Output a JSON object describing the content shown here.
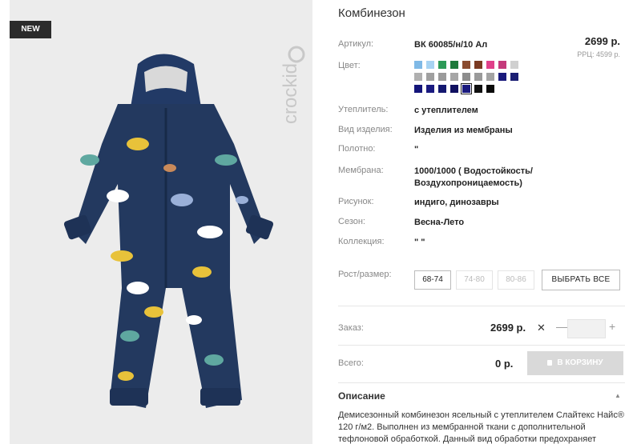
{
  "badge": "NEW",
  "brand": "crockid",
  "title": "Комбинезон",
  "article": {
    "label": "Артикул:",
    "value": "ВК 60085/н/10 Ал"
  },
  "price": "2699 р.",
  "rrp": "РРЦ: 4599 р.",
  "color": {
    "label": "Цвет:",
    "swatches": [
      "#7fb9e6",
      "#a7d3f2",
      "#2d9a57",
      "#1f7a3c",
      "#8a4b2f",
      "#7b3a22",
      "#e0408a",
      "#c43a7b",
      "#d0d0d0",
      "#b0b0b0",
      "#a0a0a0",
      "#9b9b9b",
      "#a6a6a6",
      "#8d8d8d",
      "#9a9a9a",
      "#a3a3a3",
      "#1a1a7c",
      "#1b1f73",
      "#14157a",
      "#1a1a80",
      "#141870",
      "#101060",
      "#1a1a7e",
      "#101010",
      "#0a0a0a"
    ],
    "selected_index": 22
  },
  "fields": [
    {
      "label": "Утеплитель:",
      "value": "с утеплителем"
    },
    {
      "label": "Вид изделия:",
      "value": "Изделия из мембраны"
    },
    {
      "label": "Полотно:",
      "value": "\""
    },
    {
      "label": "Мембрана:",
      "value": "1000/1000 ( Водостойкость/ Воздухопроницаемость)"
    },
    {
      "label": "Рисунок:",
      "value": "индиго, динозавры"
    },
    {
      "label": "Сезон:",
      "value": "Весна-Лето"
    },
    {
      "label": "Коллекция:",
      "value": "\" \""
    }
  ],
  "sizes": {
    "label": "Рост/размер:",
    "options": [
      {
        "label": "68-74",
        "available": true
      },
      {
        "label": "74-80",
        "available": false
      },
      {
        "label": "80-86",
        "available": false
      }
    ],
    "select_all": "ВЫБРАТЬ ВСЕ"
  },
  "order": {
    "label": "Заказ:",
    "price": "2699 р.",
    "x": "✕",
    "minus": "—",
    "plus": "+"
  },
  "total": {
    "label": "Всего:",
    "value": "0 р.",
    "cart_button": "В КОРЗИНУ"
  },
  "description": {
    "title": "Описание",
    "text": "Демисезонный комбинезон ясельный с утеплителем Слайтекс Найс® 120 г/м2. Выполнен из мембранной ткани с дополнительной тефлоновой обработкой. Данный вид обработки предохраняет"
  }
}
